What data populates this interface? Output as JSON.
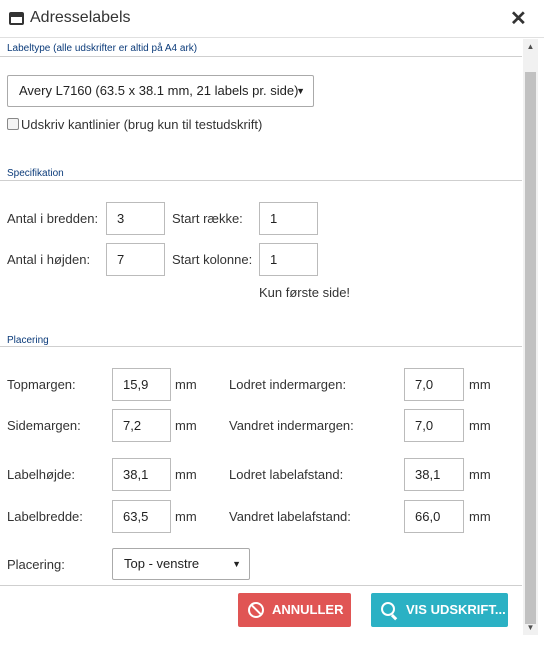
{
  "window": {
    "title": "Adresselabels",
    "icon": "window-icon",
    "close_icon": "close-icon",
    "close_glyph": "✕"
  },
  "labeltype": {
    "heading": "Labeltype (alle udskrifter er altid på A4 ark)",
    "selected": "Avery L7160 (63.5 x 38.1 mm, 21 labels pr. side)",
    "border_checkbox_label": "Udskriv kantlinier (brug kun til testudskrift)",
    "border_checked": false
  },
  "specifikation": {
    "heading": "Specifikation",
    "width_label": "Antal i bredden:",
    "width_value": "3",
    "height_label": "Antal i højden:",
    "height_value": "7",
    "start_row_label": "Start række:",
    "start_row_value": "1",
    "start_col_label": "Start kolonne:",
    "start_col_value": "1",
    "note": "Kun første side!"
  },
  "placering": {
    "heading": "Placering",
    "unit": "mm",
    "top_margin_label": "Topmargen:",
    "top_margin_value": "15,9",
    "side_margin_label": "Sidemargen:",
    "side_margin_value": "7,2",
    "label_height_label": "Labelhøjde:",
    "label_height_value": "38,1",
    "label_width_label": "Labelbredde:",
    "label_width_value": "63,5",
    "vert_inner_label": "Lodret indermargen:",
    "vert_inner_value": "7,0",
    "horiz_inner_label": "Vandret indermargen:",
    "horiz_inner_value": "7,0",
    "vert_dist_label": "Lodret labelafstand:",
    "vert_dist_value": "38,1",
    "horiz_dist_label": "Vandret labelafstand:",
    "horiz_dist_value": "66,0",
    "position_label": "Placering:",
    "position_value": "Top - venstre"
  },
  "buttons": {
    "cancel": "ANNULLER",
    "cancel_icon": "ban-icon",
    "show": "VIS UDSKRIFT...",
    "show_icon": "search-icon"
  },
  "colors": {
    "cancel_bg": "#e05554",
    "show_bg": "#2bb1c4",
    "heading": "#0b3b7a"
  }
}
